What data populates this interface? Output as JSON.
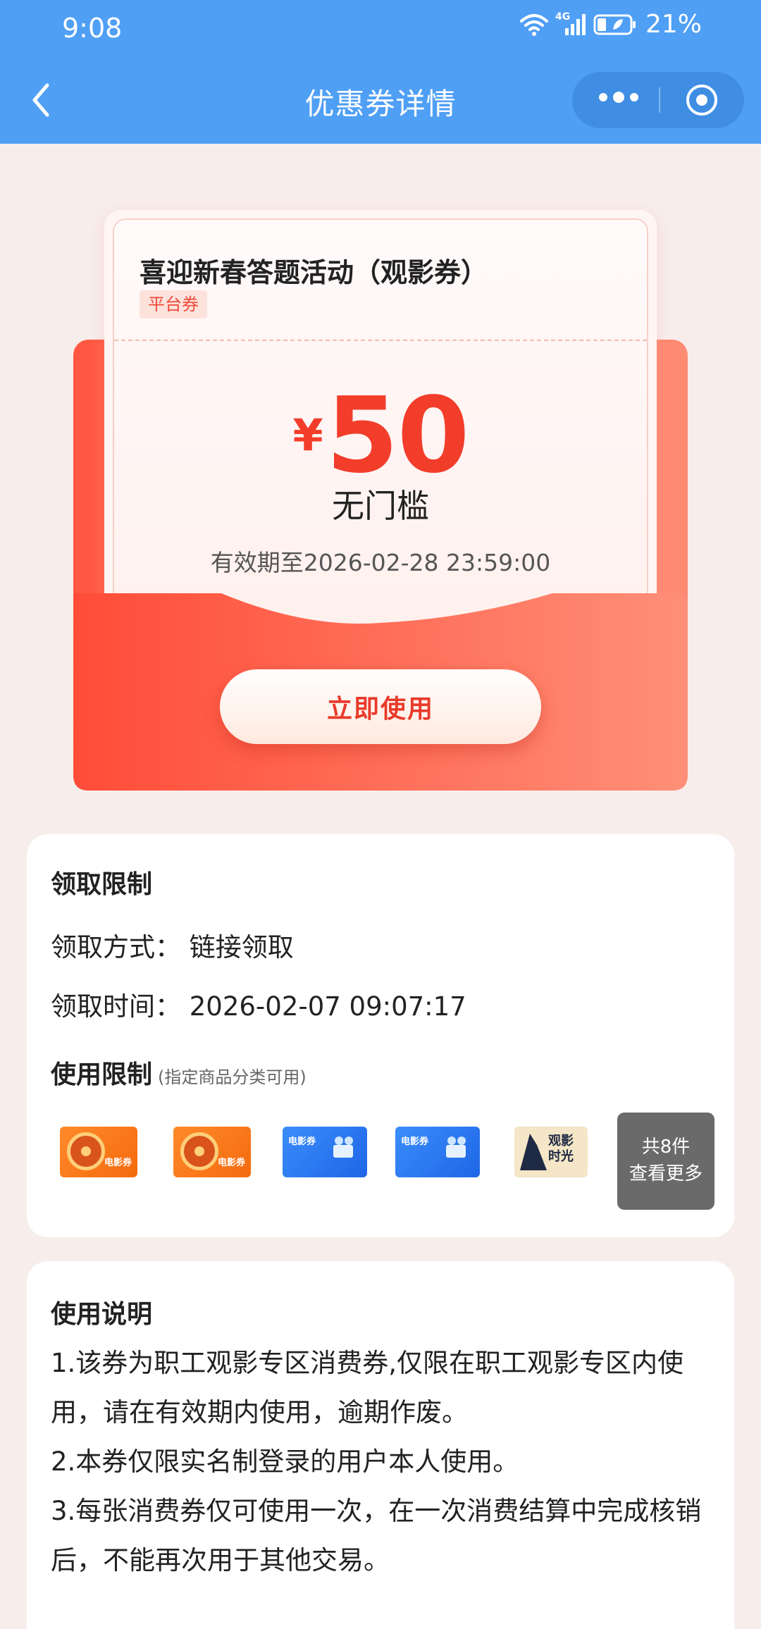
{
  "status_bar": {
    "time": "9:08",
    "network": "4G",
    "battery": "21%"
  },
  "nav": {
    "title": "优惠券详情",
    "back_icon": "chevron-left-icon",
    "more_icon": "more-dots-icon",
    "close_icon": "target-circle-icon"
  },
  "coupon": {
    "title": "喜迎新春答题活动（观影券）",
    "tag": "平台券",
    "currency": "¥",
    "amount": "50",
    "threshold": "无门槛",
    "validity": "有效期至2026-02-28 23:59:00",
    "use_button": "立即使用"
  },
  "claim_limits": {
    "title": "领取限制",
    "method": "领取方式：  链接领取",
    "time": "领取时间：  2026-02-07 09:07:17"
  },
  "use_limits": {
    "title": "使用限制",
    "subtitle": "(指定商品分类可用)",
    "thumbnails": [
      {
        "label": "电影券",
        "style": "orange"
      },
      {
        "label": "电影券",
        "style": "orange"
      },
      {
        "label": "电影券",
        "style": "blue"
      },
      {
        "label": "电影券",
        "style": "blue"
      },
      {
        "label": "观影时光",
        "style": "beige"
      }
    ],
    "more_count": "共8件",
    "more_label": "查看更多"
  },
  "instructions": {
    "title": "使用说明",
    "items": [
      "1.该券为职工观影专区消费券,仅限在职工观影专区内使用，请在有效期内使用，逾期作废。",
      "2.本券仅限实名制登录的用户本人使用。",
      "3.每张消费券仅可使用一次，在一次消费结算中完成核销后，不能再次用于其他交易。"
    ]
  },
  "colors": {
    "appbar": "#4f9ff5",
    "accent_red": "#f23d2a",
    "page_bg": "#f7eeec"
  }
}
